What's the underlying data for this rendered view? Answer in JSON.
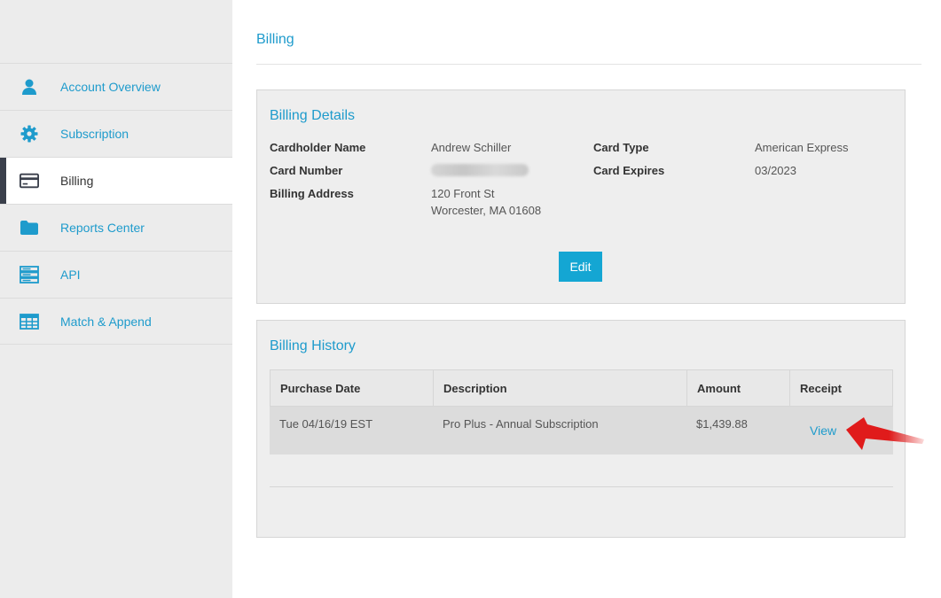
{
  "sidebar": {
    "items": [
      {
        "label": "Account Overview",
        "icon": "user-icon",
        "active": false
      },
      {
        "label": "Subscription",
        "icon": "gear-icon",
        "active": false
      },
      {
        "label": "Billing",
        "icon": "credit-card-icon",
        "active": true
      },
      {
        "label": "Reports Center",
        "icon": "folder-icon",
        "active": false
      },
      {
        "label": "API",
        "icon": "server-icon",
        "active": false
      },
      {
        "label": "Match & Append",
        "icon": "table-icon",
        "active": false
      }
    ]
  },
  "page": {
    "title": "Billing"
  },
  "billing_details": {
    "title": "Billing Details",
    "cardholder_label": "Cardholder Name",
    "cardholder_value": "Andrew Schiller",
    "card_number_label": "Card Number",
    "billing_address_label": "Billing Address",
    "address_line1": "120 Front St",
    "address_line2": "Worcester, MA 01608",
    "card_type_label": "Card Type",
    "card_type_value": "American Express",
    "card_expires_label": "Card Expires",
    "card_expires_value": "03/2023",
    "edit_label": "Edit"
  },
  "billing_history": {
    "title": "Billing History",
    "columns": [
      "Purchase Date",
      "Description",
      "Amount",
      "Receipt"
    ],
    "rows": [
      {
        "date": "Tue 04/16/19 EST",
        "description": "Pro Plus - Annual Subscription",
        "amount": "$1,439.88",
        "receipt": "View"
      }
    ]
  },
  "colors": {
    "accent": "#1e9bcc",
    "button": "#14a6d3",
    "sidebar_bg": "#ececec",
    "active_bar": "#3a3f4b",
    "arrow": "#e01b1b"
  }
}
